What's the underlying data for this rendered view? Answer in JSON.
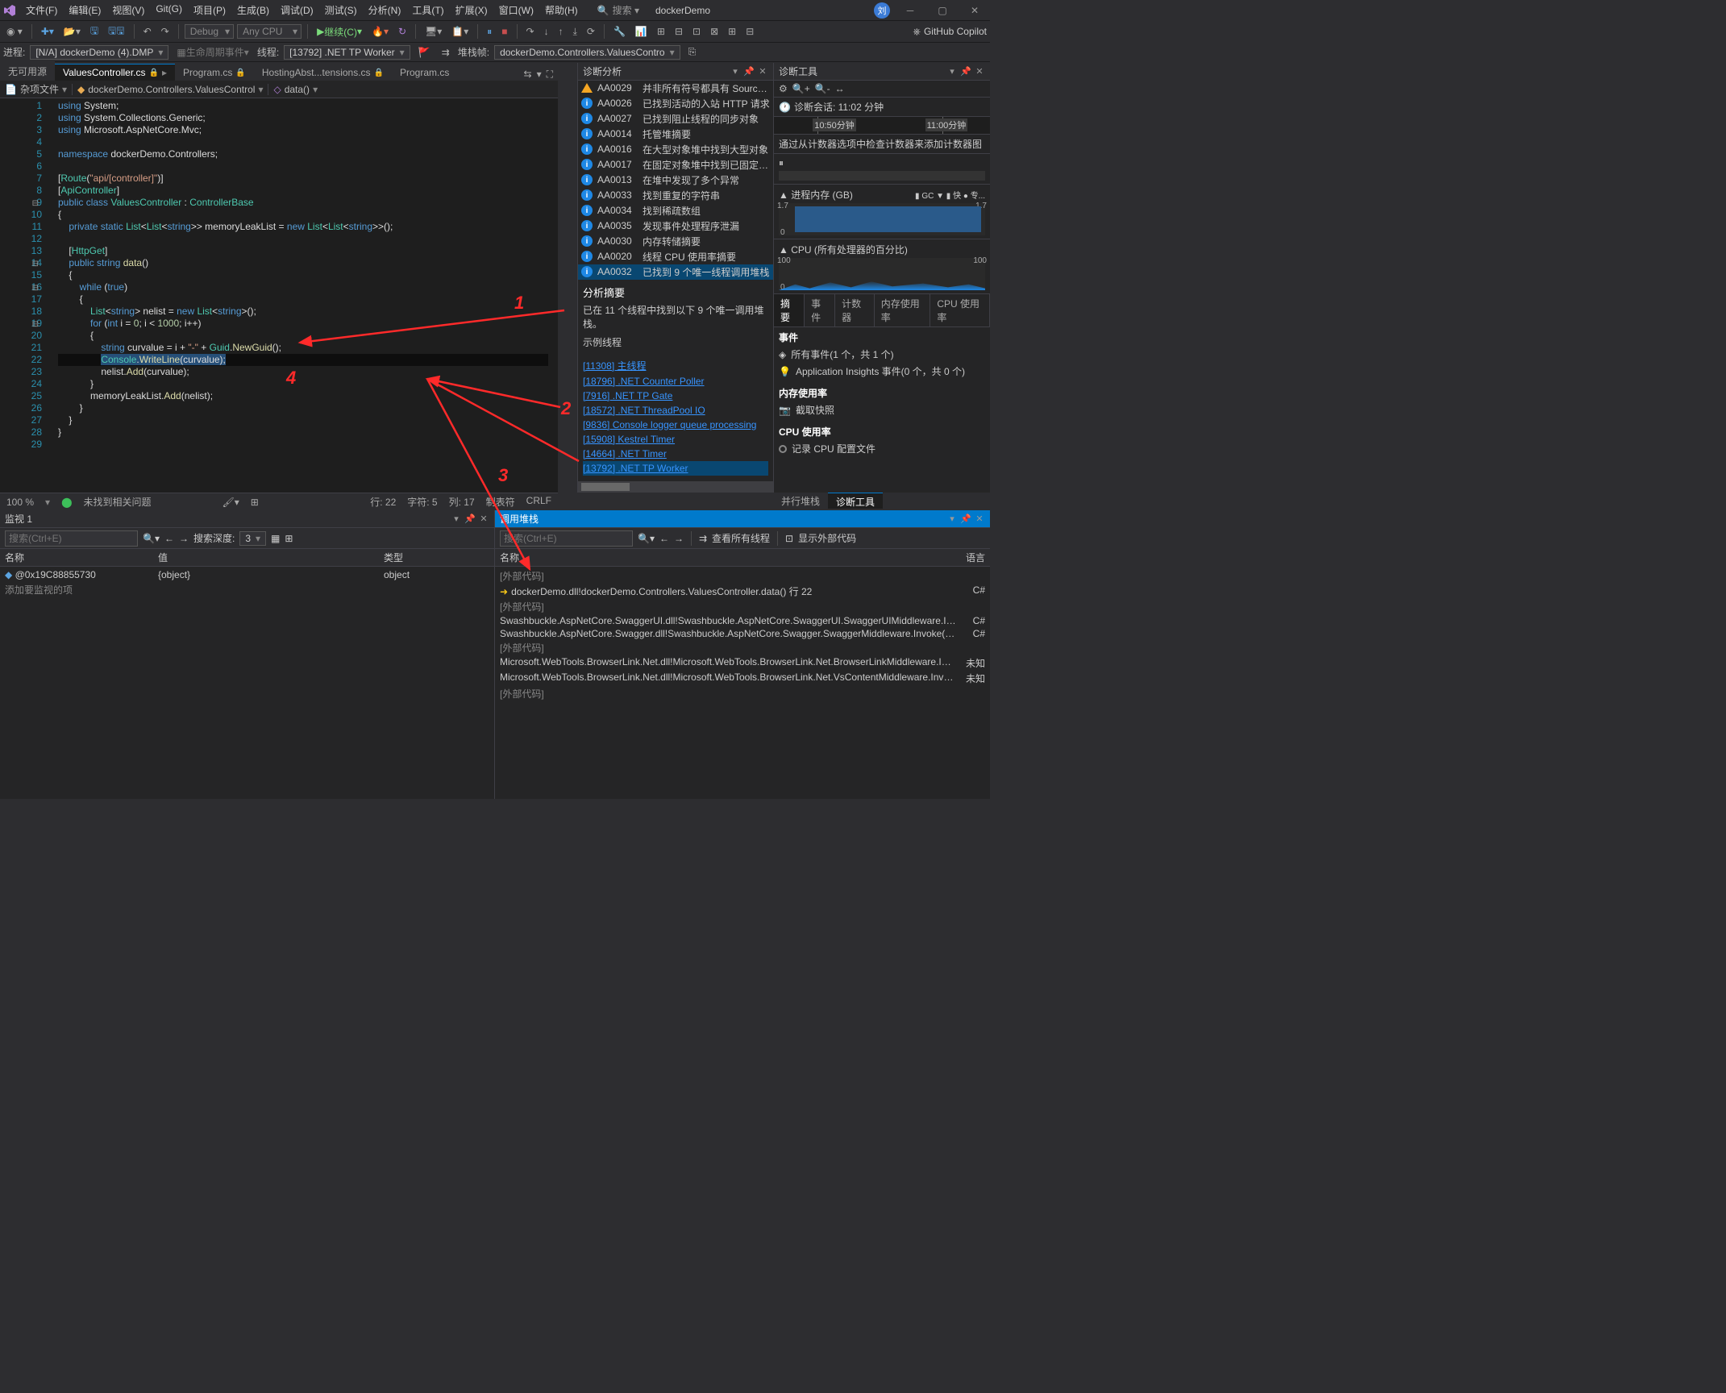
{
  "app": {
    "title": "dockerDemo",
    "avatar": "刘"
  },
  "menus": [
    "文件(F)",
    "编辑(E)",
    "视图(V)",
    "Git(G)",
    "项目(P)",
    "生成(B)",
    "调试(D)",
    "测试(S)",
    "分析(N)",
    "工具(T)",
    "扩展(X)",
    "窗口(W)",
    "帮助(H)"
  ],
  "search_placeholder": "搜索 ▾",
  "copilot": "GitHub Copilot",
  "toolbar": {
    "config": "Debug",
    "platform": "Any CPU",
    "continue": "继续(C)"
  },
  "procbar": {
    "proc_label": "进程:",
    "proc": "[N/A] dockerDemo (4).DMP",
    "life_label": "生命周期事件",
    "thread_label": "线程:",
    "thread": "[13792] .NET TP Worker",
    "stack_label": "堆栈帧:",
    "stack": "dockerDemo.Controllers.ValuesContro"
  },
  "tabs": [
    {
      "label": "无可用源",
      "active": false
    },
    {
      "label": "ValuesController.cs",
      "active": true,
      "pinned": true
    },
    {
      "label": "Program.cs",
      "active": false,
      "pinned": true
    },
    {
      "label": "HostingAbst...tensions.cs",
      "active": false,
      "pinned": true
    },
    {
      "label": "Program.cs",
      "active": false
    }
  ],
  "crumbs": {
    "scope": "杂项文件",
    "ns": "dockerDemo.Controllers.ValuesControl",
    "method": "data()"
  },
  "code": {
    "lines": [
      {
        "n": 1,
        "html": "<span class='kw'>using</span> System;"
      },
      {
        "n": 2,
        "html": "<span class='kw'>using</span> System.Collections.Generic;"
      },
      {
        "n": 3,
        "html": "<span class='kw'>using</span> Microsoft.AspNetCore.Mvc;"
      },
      {
        "n": 4,
        "html": ""
      },
      {
        "n": 5,
        "html": "<span class='kw'>namespace</span> dockerDemo.Controllers;"
      },
      {
        "n": 6,
        "html": ""
      },
      {
        "n": 7,
        "html": "[<span class='attr'>Route</span>(<span class='str'>\"api/[controller]\"</span>)]"
      },
      {
        "n": 8,
        "html": "[<span class='attr'>ApiController</span>]"
      },
      {
        "n": 9,
        "html": "<span class='kw'>public</span> <span class='kw'>class</span> <span class='cls'>ValuesController</span> : <span class='cls'>ControllerBase</span>",
        "fold": true
      },
      {
        "n": 10,
        "html": "{"
      },
      {
        "n": 11,
        "html": "    <span class='kw'>private</span> <span class='kw'>static</span> <span class='cls'>List</span>&lt;<span class='cls'>List</span>&lt;<span class='kw'>string</span>&gt;&gt; memoryLeakList = <span class='kw'>new</span> <span class='cls'>List</span>&lt;<span class='cls'>List</span>&lt;<span class='kw'>string</span>&gt;&gt;();"
      },
      {
        "n": 12,
        "html": ""
      },
      {
        "n": 13,
        "html": "    [<span class='attr'>HttpGet</span>]"
      },
      {
        "n": 14,
        "html": "    <span class='kw'>public</span> <span class='kw'>string</span> <span class='mth'>data</span>()",
        "fold": true
      },
      {
        "n": 15,
        "html": "    {"
      },
      {
        "n": 16,
        "html": "        <span class='kw'>while</span> (<span class='kw'>true</span>)",
        "fold": true
      },
      {
        "n": 17,
        "html": "        {"
      },
      {
        "n": 18,
        "html": "            <span class='cls'>List</span>&lt;<span class='kw'>string</span>&gt; nelist = <span class='kw'>new</span> <span class='cls'>List</span>&lt;<span class='kw'>string</span>&gt;();"
      },
      {
        "n": 19,
        "html": "            <span class='kw'>for</span> (<span class='kw'>int</span> i = <span class='num'>0</span>; i &lt; <span class='num'>1000</span>; i++)",
        "fold": true
      },
      {
        "n": 20,
        "html": "            {"
      },
      {
        "n": 21,
        "html": "                <span class='kw'>string</span> curvalue = i + <span class='str'>\"-\"</span> + <span class='cls'>Guid</span>.<span class='mth'>NewGuid</span>();"
      },
      {
        "n": 22,
        "html": "                <span class='hl'><span class='cls'>Console</span>.<span class='mth'>WriteLine</span>(curvalue);</span>",
        "cur": true
      },
      {
        "n": 23,
        "html": "                nelist.<span class='mth'>Add</span>(curvalue);"
      },
      {
        "n": 24,
        "html": "            }"
      },
      {
        "n": 25,
        "html": "            memoryLeakList.<span class='mth'>Add</span>(nelist);"
      },
      {
        "n": 26,
        "html": "        }"
      },
      {
        "n": 27,
        "html": "    }"
      },
      {
        "n": 28,
        "html": "}"
      },
      {
        "n": 29,
        "html": ""
      }
    ]
  },
  "editor_status": {
    "zoom": "100 %",
    "issues": "未找到相关问题",
    "line": "行: 22",
    "col": "字符: 5",
    "colnum": "列: 17",
    "ins": "制表符",
    "eol": "CRLF"
  },
  "diag_analysis": {
    "title": "诊断分析",
    "rows": [
      {
        "icon": "warn",
        "code": "AA0029",
        "msg": "并非所有符号都具有 Source Lir"
      },
      {
        "icon": "info",
        "code": "AA0026",
        "msg": "已找到活动的入站 HTTP 请求"
      },
      {
        "icon": "info",
        "code": "AA0027",
        "msg": "已找到阻止线程的同步对象"
      },
      {
        "icon": "info",
        "code": "AA0014",
        "msg": "托管堆摘要"
      },
      {
        "icon": "info",
        "code": "AA0016",
        "msg": "在大型对象堆中找到大型对象"
      },
      {
        "icon": "info",
        "code": "AA0017",
        "msg": "在固定对象堆中找到已固定对象"
      },
      {
        "icon": "info",
        "code": "AA0013",
        "msg": "在堆中发现了多个异常"
      },
      {
        "icon": "info",
        "code": "AA0033",
        "msg": "找到重复的字符串"
      },
      {
        "icon": "info",
        "code": "AA0034",
        "msg": "找到稀疏数组"
      },
      {
        "icon": "info",
        "code": "AA0035",
        "msg": "发现事件处理程序泄漏"
      },
      {
        "icon": "info",
        "code": "AA0030",
        "msg": "内存转储摘要"
      },
      {
        "icon": "info",
        "code": "AA0020",
        "msg": "线程 CPU 使用率摘要"
      },
      {
        "icon": "info",
        "code": "AA0032",
        "msg": "已找到 9 个唯一线程调用堆栈",
        "sel": true
      }
    ],
    "summary_title": "分析摘要",
    "summary_body": "已在 11 个线程中找到以下 9 个唯一调用堆栈。",
    "sample_label": "示例线程",
    "links": [
      "[11308] 主线程",
      "[18796] .NET Counter Poller",
      "[7916] .NET TP Gate",
      "[18572] .NET ThreadPool IO",
      "[9836] Console logger queue processing",
      "[15908] Kestrel Timer",
      "[14664] .NET Timer",
      "[13792] .NET TP Worker"
    ]
  },
  "diag_tools": {
    "title": "诊断工具",
    "session": "诊断会话: 11:02 分钟",
    "time_marks": [
      "10:50分钟",
      "11:00分钟"
    ],
    "hint": "通过从计数器选项中检查计数器来添加计数器图",
    "mem_title": "▲ 进程内存 (GB)",
    "mem_badges": "▮ GC ▼ ▮ 快 ● 专...",
    "mem_hi": "1.7",
    "mem_lo": "0",
    "cpu_title": "▲ CPU (所有处理器的百分比)",
    "cpu_hi": "100",
    "cpu_lo": "0",
    "sub_tabs": [
      "摘要",
      "事件",
      "计数器",
      "内存使用率",
      "CPU 使用率"
    ],
    "events": {
      "title": "事件",
      "row1": "所有事件(1 个，共 1 个)",
      "row2": "Application Insights 事件(0 个，共 0 个)"
    },
    "mem": {
      "title": "内存使用率",
      "row": "截取快照"
    },
    "cpu": {
      "title": "CPU 使用率",
      "row": "记录 CPU 配置文件"
    },
    "footer_tabs": [
      "并行堆栈",
      "诊断工具"
    ]
  },
  "watch": {
    "title": "监视 1",
    "search_ph": "搜索(Ctrl+E)",
    "depth_label": "搜索深度:",
    "depth": "3",
    "cols": [
      "名称",
      "值",
      "类型"
    ],
    "rows": [
      {
        "name": "@0x19C88855730",
        "val": "{object}",
        "type": "object"
      }
    ],
    "add": "添加要监视的项"
  },
  "callstack": {
    "title": "调用堆栈",
    "search_ph": "搜索(Ctrl+E)",
    "view_all": "查看所有线程",
    "show_ext": "显示外部代码",
    "cols": [
      "名称",
      "语言"
    ],
    "rows": [
      {
        "name": "[外部代码]",
        "ext": true
      },
      {
        "name": "dockerDemo.dll!dockerDemo.Controllers.ValuesController.data() 行 22",
        "lang": "C#",
        "cur": true
      },
      {
        "name": "[外部代码]",
        "ext": true
      },
      {
        "name": "Swashbuckle.AspNetCore.SwaggerUI.dll!Swashbuckle.AspNetCore.SwaggerUI.SwaggerUIMiddleware.Invoke(Microsoft.A...",
        "lang": "C#"
      },
      {
        "name": "Swashbuckle.AspNetCore.Swagger.dll!Swashbuckle.AspNetCore.Swagger.SwaggerMiddleware.Invoke(Microsoft.AspNet...",
        "lang": "C#"
      },
      {
        "name": "[外部代码]",
        "ext": true
      },
      {
        "name": "Microsoft.WebTools.BrowserLink.Net.dll!Microsoft.WebTools.BrowserLink.Net.BrowserLinkMiddleware.InvokeAsync(Micro...",
        "lang": "未知"
      },
      {
        "name": "Microsoft.WebTools.BrowserLink.Net.dll!Microsoft.WebTools.BrowserLink.Net.VsContentMiddleware.InvokeAsync(Micros...",
        "lang": "未知"
      },
      {
        "name": "[外部代码]",
        "ext": true
      }
    ]
  },
  "annotations": {
    "1": "1",
    "2": "2",
    "3": "3",
    "4": "4"
  }
}
